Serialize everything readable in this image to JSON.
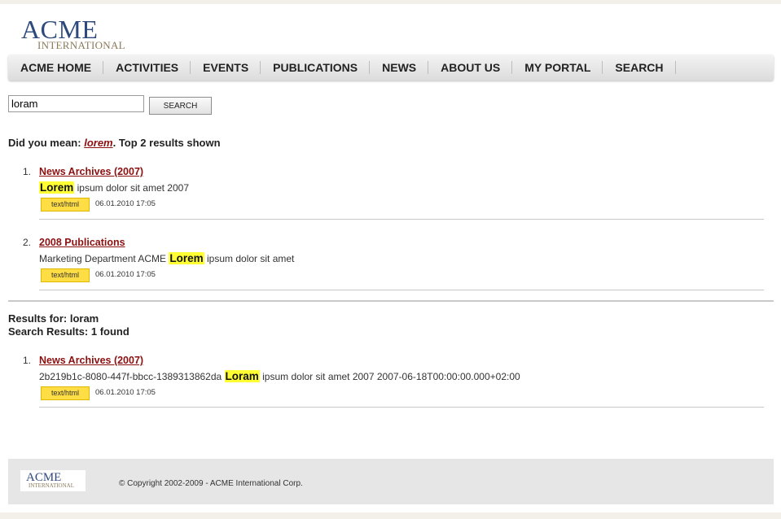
{
  "logo": {
    "main": "ACME",
    "sub": "INTERNATIONAL"
  },
  "nav": [
    "ACME HOME",
    "ACTIVITIES",
    "EVENTS",
    "PUBLICATIONS",
    "NEWS",
    "ABOUT US",
    "MY PORTAL",
    "SEARCH"
  ],
  "search": {
    "value": "loram",
    "button": "SEARCH"
  },
  "suggestion": {
    "prefix": "Did you mean:",
    "term": "lorem",
    "suffix": ". Top 2 results shown"
  },
  "top_results": [
    {
      "num": "1.",
      "title": "News Archives (2007)",
      "before": "",
      "highlight": "Lorem",
      "after": " ipsum dolor sit amet 2007",
      "type": "text/html",
      "date": "06.01.2010 17:05"
    },
    {
      "num": "2.",
      "title": "2008 Publications",
      "before": "Marketing Department ACME ",
      "highlight": "Lorem",
      "after": " ipsum dolor sit amet",
      "type": "text/html",
      "date": "06.01.2010 17:05"
    }
  ],
  "results_for": {
    "label": "Results for: loram",
    "count": "Search Results: 1 found"
  },
  "found_results": [
    {
      "num": "1.",
      "title": "News Archives (2007)",
      "before": "2b219b1c-8080-447f-bbcc-1389313862da ",
      "highlight": "Loram",
      "after": " ipsum dolor sit amet 2007 2007-06-18T00:00:00.000+02:00",
      "type": "text/html",
      "date": "06.01.2010 17:05"
    }
  ],
  "footer": {
    "logo_main": "ACME",
    "logo_sub": "INTERNATIONAL",
    "copyright": "© Copyright 2002-2009 - ACME International Corp."
  }
}
